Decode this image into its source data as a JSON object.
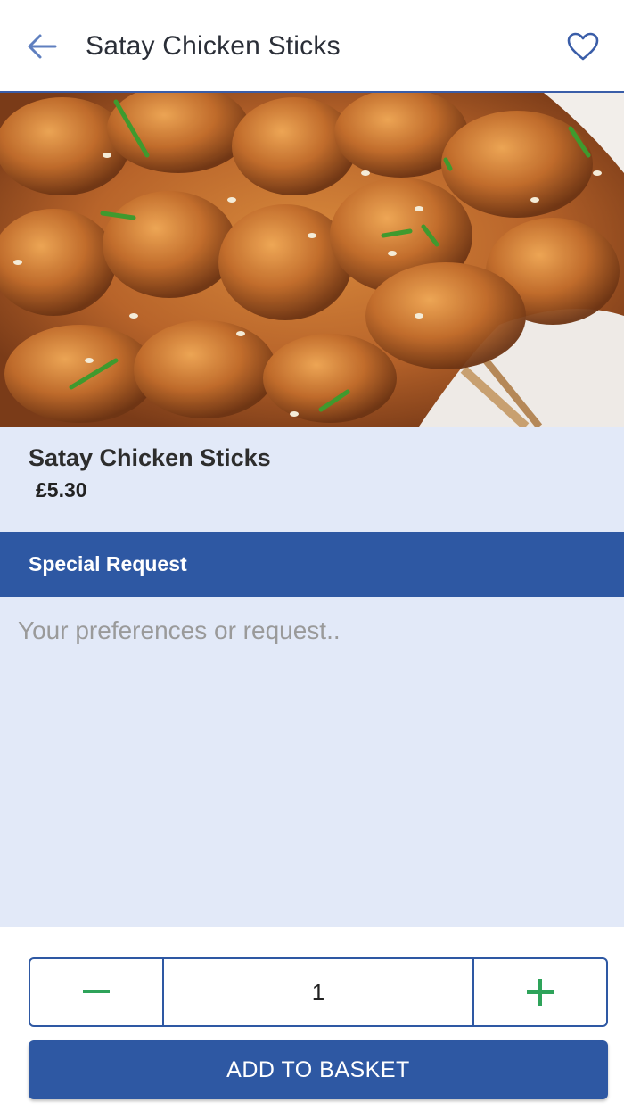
{
  "header": {
    "title": "Satay Chicken Sticks",
    "back_icon": "arrow-left-icon",
    "favorite_icon": "heart-outline-icon",
    "accent_color": "#3a5da8"
  },
  "item": {
    "image_alt": "Satay chicken skewers",
    "name": "Satay Chicken Sticks",
    "price": "£5.30"
  },
  "special_request": {
    "title": "Special Request",
    "placeholder": "Your preferences or request..",
    "value": ""
  },
  "quantity": {
    "decrement_icon": "minus-icon",
    "increment_icon": "plus-icon",
    "value": "1"
  },
  "actions": {
    "add_to_basket_label": "ADD TO BASKET"
  },
  "colors": {
    "primary": "#2e58a3",
    "panel_background": "#e2e9f8",
    "stepper_icon": "#2ea35a"
  }
}
